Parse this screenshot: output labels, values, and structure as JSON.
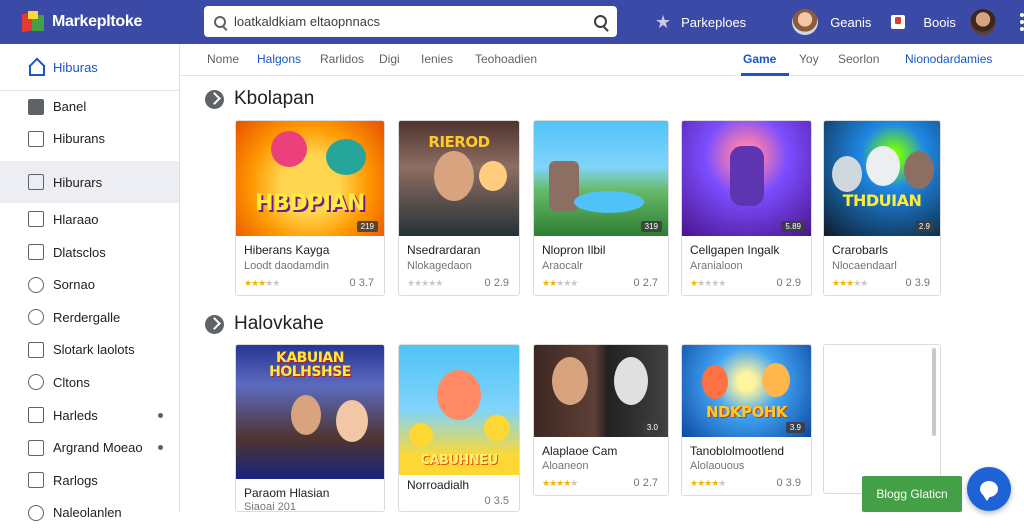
{
  "app": {
    "logo_text": "Markepltoke"
  },
  "search": {
    "value": "loatkaldkiam eltaopnnacs"
  },
  "header": {
    "link": "Parkeploes",
    "user1": "Geanis",
    "user2": "Boois"
  },
  "sidebar": {
    "items": [
      {
        "label": "Hiburas",
        "icon": "home-icon"
      },
      {
        "label": "Banel",
        "icon": "panel-icon"
      },
      {
        "label": "Hiburans",
        "icon": "library-icon"
      },
      {
        "label": "Hiburars",
        "icon": "bookmark-icon"
      },
      {
        "label": "Hlaraao",
        "icon": "grid-icon"
      },
      {
        "label": "Dlatsclos",
        "icon": "chart-icon"
      },
      {
        "label": "Sornao",
        "icon": "settings-icon"
      },
      {
        "label": "Rerdergalle",
        "icon": "clock-icon"
      },
      {
        "label": "Slotark laolots",
        "icon": "list-icon"
      },
      {
        "label": "Cltons",
        "icon": "gear-icon"
      },
      {
        "label": "Harleds",
        "icon": "flag-icon"
      },
      {
        "label": "Argrand Moeao",
        "icon": "folder-icon"
      },
      {
        "label": "Rarlogs",
        "icon": "edit-icon"
      },
      {
        "label": "Naleolanlen",
        "icon": "info-icon"
      }
    ]
  },
  "tabs": [
    "Nome",
    "Halgons",
    "Rarlidos",
    "Digi",
    "Ienies",
    "Teohoadien",
    "Game",
    "Yoy",
    "Seorlon",
    "Nionodardamies"
  ],
  "sections": [
    {
      "title": "Kbolapan",
      "cards": [
        {
          "thumb_label": "HBDPIAN",
          "tag": "219",
          "title": "Hiberans Kayga",
          "sub": "Loodt daodamdin",
          "rating": 4,
          "score": "0 3.7"
        },
        {
          "thumb_label": "RIEROD",
          "tag": "",
          "title": "Nsedrardaran",
          "sub": "Nlokagedaon",
          "rating": 0,
          "score": "0 2.9"
        },
        {
          "thumb_label": "",
          "tag": "319",
          "title": "Nlopron Ilbil",
          "sub": "Araocalr",
          "rating": 2,
          "score": "0 2.7"
        },
        {
          "thumb_label": "",
          "tag": "5.89",
          "title": "Cellgapen Ingalk",
          "sub": "Aranialoon",
          "rating": 1,
          "score": "0 2.9"
        },
        {
          "thumb_label": "THDUIAN",
          "tag": "2.9",
          "title": "Crarobarls",
          "sub": "Nlocaendaarl",
          "rating": 3,
          "score": "0 3.9"
        }
      ]
    },
    {
      "title": "Halovkahe",
      "cards": [
        {
          "thumb_label": "KABUIAN HOLHSHSE",
          "tag": "",
          "title": "Paraom Hlasian",
          "sub": "Siaoai 201",
          "rating": 0,
          "score": ""
        },
        {
          "thumb_label": "CABUHNEU",
          "tag": "",
          "title": "Norroadialh",
          "sub": "",
          "rating": 0,
          "score": "0 3.5"
        },
        {
          "thumb_label": "",
          "tag": "3.0",
          "title": "Alaplaoe Cam",
          "sub": "Aloaneon",
          "rating": 4,
          "score": "0 2.7"
        },
        {
          "thumb_label": "NDKPOHK",
          "tag": "3.9",
          "title": "Tanoblolmootlend",
          "sub": "Alolaouous",
          "rating": 4,
          "score": "0 3.9"
        }
      ]
    }
  ],
  "cta": {
    "label": "Blogg Glaticn"
  },
  "colors": {
    "topbar": "#3b4aa6",
    "accent": "#1a56c8",
    "cta": "#43a047",
    "fab": "#1e63d6"
  }
}
